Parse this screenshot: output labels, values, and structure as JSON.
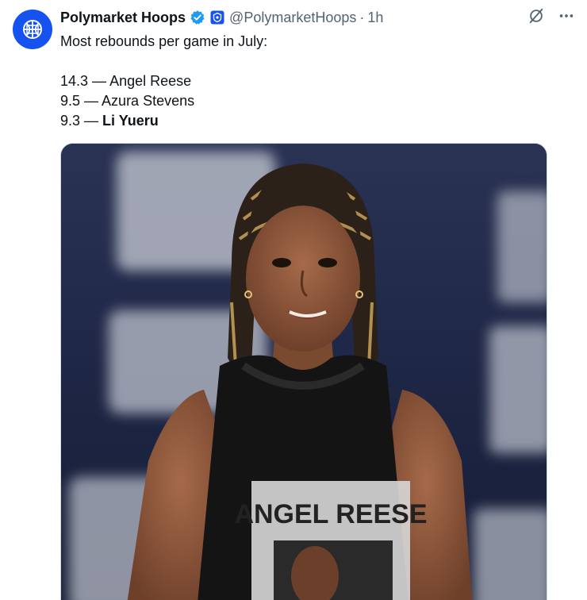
{
  "author": {
    "display_name": "Polymarket Hoops",
    "handle": "@PolymarketHoops",
    "separator": "·",
    "time": "1h",
    "verified": true,
    "avatar_icon": "basketball-globe-icon",
    "brand_color": "#1652f0",
    "verified_color": "#1d9bf0"
  },
  "tweet": {
    "intro": "Most rebounds per game in July:",
    "rankings": [
      {
        "value": "14.3",
        "sep": " — ",
        "name": "Angel Reese"
      },
      {
        "value": "9.5",
        "sep": " — ",
        "name": "Azura Stevens"
      },
      {
        "value": "9.3",
        "sep": " — ",
        "name": "Li Yueru"
      }
    ]
  },
  "actions": {
    "grok_icon": "grok-icon",
    "more_icon": "more-options-icon"
  },
  "media": {
    "shirt_text": "ANGEL REESE"
  }
}
